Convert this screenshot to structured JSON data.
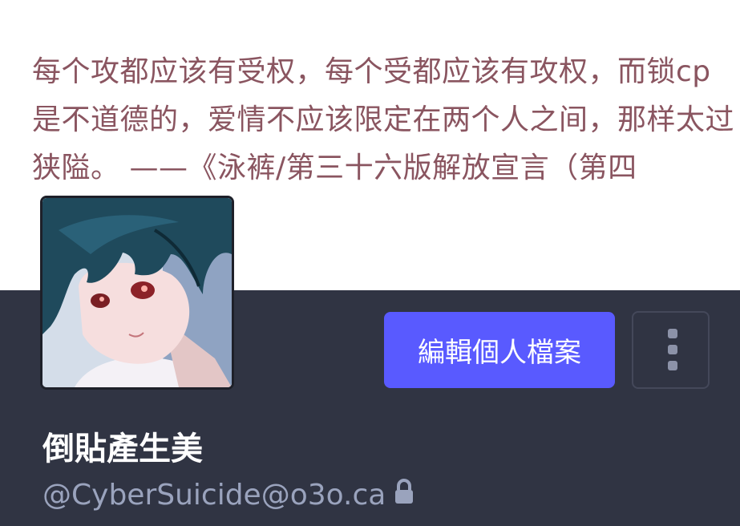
{
  "header": {
    "text": "每个攻都应该有受权，每个受都应该有攻权，而锁cp是不道德的，爱情不应该限定在两个人之间，那样太过狭隘。 ——《泳裤/第三十六版解放宣言（第四"
  },
  "profile": {
    "avatar": "anime-avatar-dark-teal-hair-red-eyes",
    "display_name": "倒貼產生美",
    "handle": "@CyberSuicide@o3o.ca",
    "locked_icon": "lock-icon"
  },
  "actions": {
    "edit_profile_label": "編輯個人檔案",
    "more_icon": "vertical-dots-icon"
  },
  "colors": {
    "panel_bg": "#303443",
    "accent": "#595aff",
    "header_text": "#8a5560",
    "handle_text": "#9aa3bd"
  }
}
